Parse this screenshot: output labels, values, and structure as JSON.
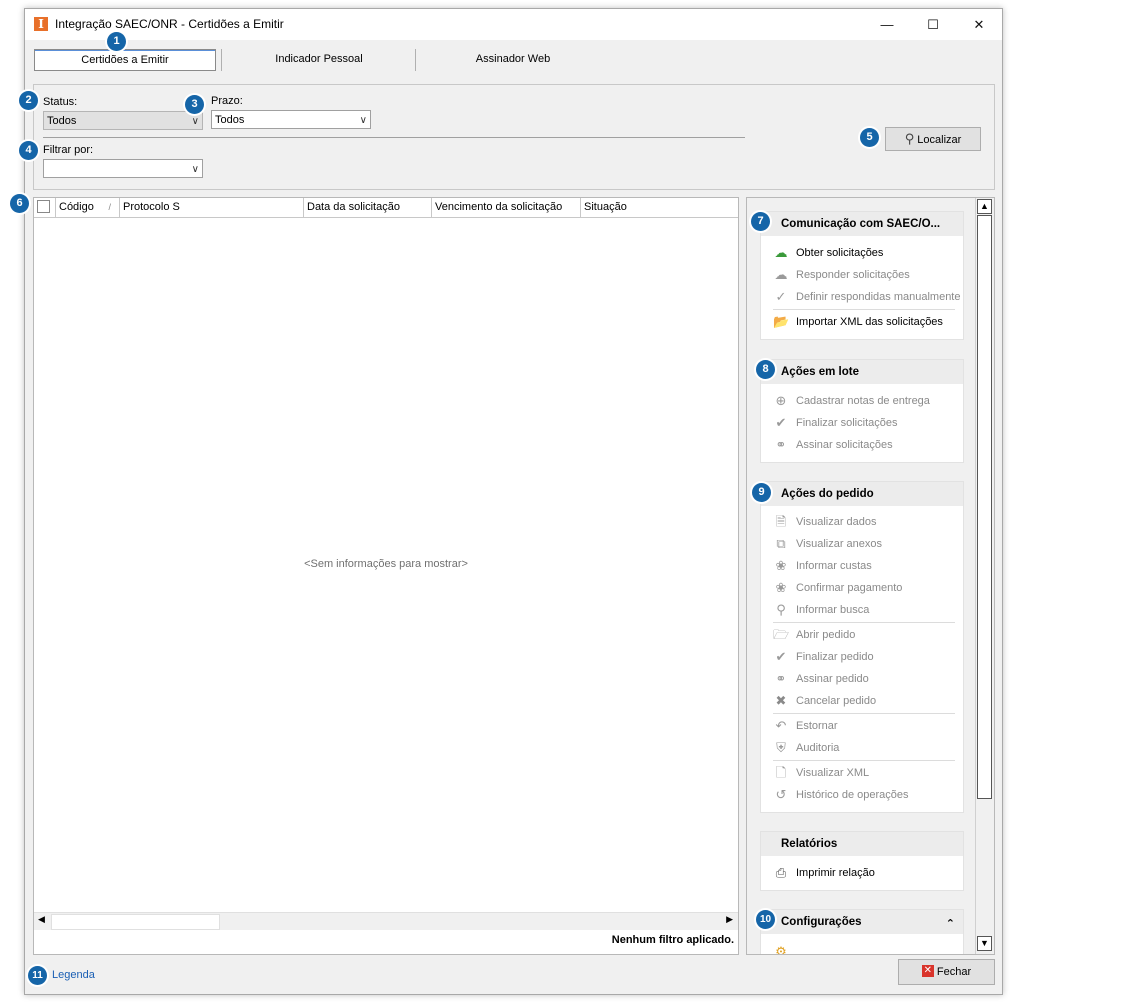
{
  "window": {
    "title": "Integração SAEC/ONR - Certidões a Emitir",
    "app_icon_letter": "I",
    "controls": {
      "minimize": "—",
      "maximize": "☐",
      "close": "✕"
    }
  },
  "tabs": [
    {
      "label": "Certidões a Emitir",
      "active": true
    },
    {
      "label": "Indicador Pessoal",
      "active": false
    },
    {
      "label": "Assinador Web",
      "active": false
    }
  ],
  "filters": {
    "status_label": "Status:",
    "status_value": "Todos",
    "prazo_label": "Prazo:",
    "prazo_value": "Todos",
    "filtrar_label": "Filtrar por:",
    "filtrar_value": "",
    "localizar_label": "Localizar"
  },
  "grid": {
    "columns": [
      "Código",
      "Protocolo S",
      "Data da solicitação",
      "Vencimento da solicitação",
      "Situação"
    ],
    "sort_indicator": "/",
    "empty_message": "<Sem informações para mostrar>",
    "status_text": "Nenhum filtro aplicado."
  },
  "sidebar": {
    "comunicacao": {
      "title": "Comunicação com SAEC/O...",
      "items": [
        {
          "label": "Obter solicitações",
          "icon": "cloud-download-icon",
          "enabled": true
        },
        {
          "label": "Responder solicitações",
          "icon": "cloud-upload-icon",
          "enabled": false
        },
        {
          "label": "Definir respondidas manualmente",
          "icon": "check-icon",
          "enabled": false
        },
        {
          "label": "Importar XML das solicitações",
          "icon": "folder-import-icon",
          "enabled": true
        }
      ]
    },
    "acoes_lote": {
      "title": "Ações em lote",
      "items": [
        {
          "label": "Cadastrar notas de entrega",
          "icon": "plus-circle-icon",
          "enabled": false
        },
        {
          "label": "Finalizar solicitações",
          "icon": "check-circle-icon",
          "enabled": false
        },
        {
          "label": "Assinar solicitações",
          "icon": "ribbon-icon",
          "enabled": false
        }
      ]
    },
    "acoes_pedido": {
      "title": "Ações do pedido",
      "items": [
        {
          "label": "Visualizar dados",
          "icon": "document-search-icon",
          "enabled": false
        },
        {
          "label": "Visualizar anexos",
          "icon": "attachments-icon",
          "enabled": false
        },
        {
          "label": "Informar custas",
          "icon": "tag-icon",
          "enabled": false
        },
        {
          "label": "Confirmar pagamento",
          "icon": "tag-check-icon",
          "enabled": false
        },
        {
          "label": "Informar busca",
          "icon": "search-icon",
          "enabled": false
        },
        {
          "label": "Abrir pedido",
          "icon": "folder-open-icon",
          "enabled": false
        },
        {
          "label": "Finalizar pedido",
          "icon": "check-circle-icon",
          "enabled": false
        },
        {
          "label": "Assinar pedido",
          "icon": "ribbon-icon",
          "enabled": false
        },
        {
          "label": "Cancelar pedido",
          "icon": "x-circle-icon",
          "enabled": false
        },
        {
          "label": "Estornar",
          "icon": "undo-icon",
          "enabled": false
        },
        {
          "label": "Auditoria",
          "icon": "shield-icon",
          "enabled": false
        },
        {
          "label": "Visualizar XML",
          "icon": "xml-document-icon",
          "enabled": false
        },
        {
          "label": "Histórico de operações",
          "icon": "history-icon",
          "enabled": false
        }
      ]
    },
    "relatorios": {
      "title": "Relatórios",
      "items": [
        {
          "label": "Imprimir relação",
          "icon": "printer-icon",
          "enabled": true
        }
      ]
    },
    "configuracoes": {
      "title": "Configurações",
      "collapse_glyph": "⌃"
    }
  },
  "footer": {
    "legenda_label": "Legenda",
    "fechar_label": "Fechar"
  },
  "badges": [
    "1",
    "2",
    "3",
    "4",
    "5",
    "6",
    "7",
    "8",
    "9",
    "10",
    "11"
  ],
  "colors": {
    "badge": "#1565a8",
    "app_icon": "#e8702a",
    "link": "#1a5fb4",
    "close_icon": "#d9342b"
  }
}
